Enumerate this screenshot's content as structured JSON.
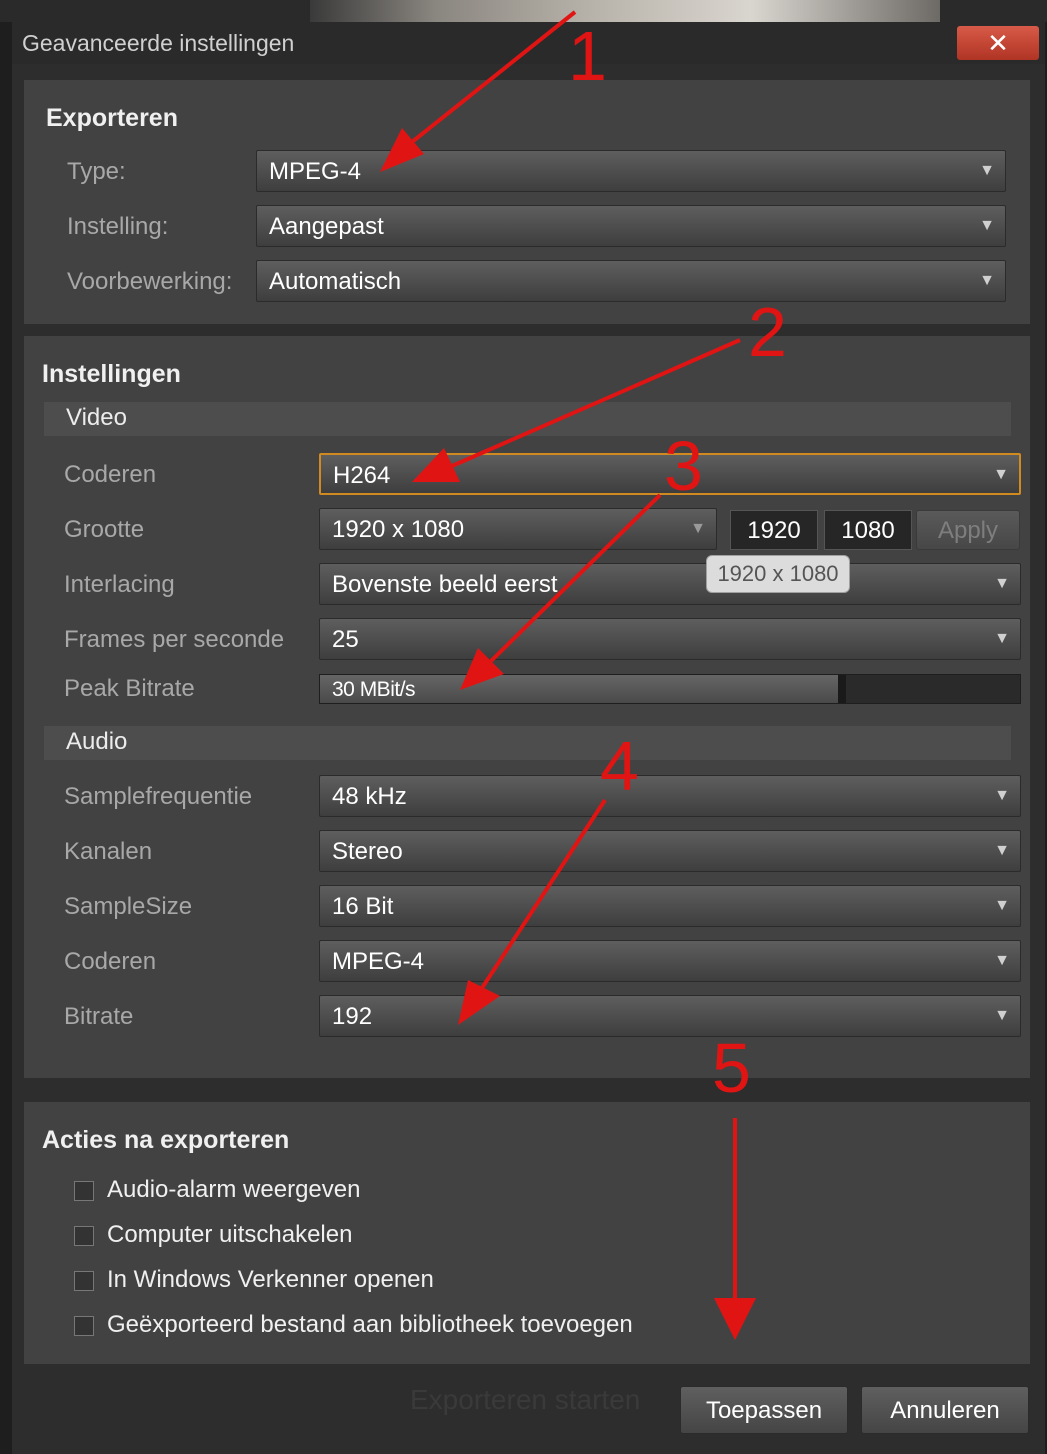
{
  "window": {
    "title": "Geavanceerde instellingen",
    "close_symbol": "✕"
  },
  "export": {
    "title": "Exporteren",
    "rows": [
      {
        "label": "Type:",
        "value": "MPEG-4"
      },
      {
        "label": "Instelling:",
        "value": "Aangepast"
      },
      {
        "label": "Voorbewerking:",
        "value": "Automatisch"
      }
    ]
  },
  "settings": {
    "title": "Instellingen",
    "video": {
      "header": "Video",
      "encode": {
        "label": "Coderen",
        "value": "H264"
      },
      "size": {
        "label": "Grootte",
        "value": "1920 x 1080",
        "width": "1920",
        "height": "1080",
        "apply_label": "Apply",
        "tooltip": "1920 x 1080"
      },
      "interlacing": {
        "label": "Interlacing",
        "value": "Bovenste beeld eerst"
      },
      "fps": {
        "label": "Frames per seconde",
        "value": "25"
      },
      "peak_bitrate": {
        "label": "Peak Bitrate",
        "value": "30 MBit/s",
        "level": 0.74
      }
    },
    "audio": {
      "header": "Audio",
      "rows": [
        {
          "label": "Samplefrequentie",
          "value": "48 kHz"
        },
        {
          "label": "Kanalen",
          "value": "Stereo"
        },
        {
          "label": "SampleSize",
          "value": "16 Bit"
        },
        {
          "label": "Coderen",
          "value": "MPEG-4"
        },
        {
          "label": "Bitrate",
          "value": "192"
        }
      ]
    }
  },
  "after_export": {
    "title": "Acties na exporteren",
    "options": [
      {
        "label": "Audio-alarm weergeven",
        "checked": false
      },
      {
        "label": "Computer uitschakelen",
        "checked": false
      },
      {
        "label": "In Windows Verkenner openen",
        "checked": false
      },
      {
        "label": "Geëxporteerd bestand aan bibliotheek toevoegen",
        "checked": false
      }
    ]
  },
  "footer": {
    "background_text": "Exporteren starten",
    "apply_label": "Toepassen",
    "cancel_label": "Annuleren"
  },
  "annotations": {
    "color": "#e11414",
    "numbers": [
      "1",
      "2",
      "3",
      "4",
      "5"
    ]
  },
  "colors": {
    "panel": "#424242",
    "focus": "#d08a20",
    "close": "#c8402f"
  }
}
